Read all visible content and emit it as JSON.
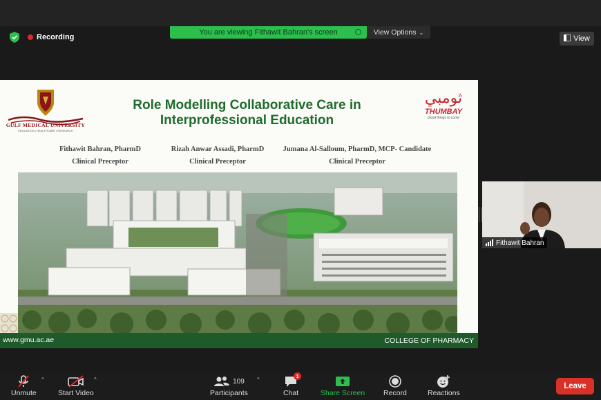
{
  "banner": {
    "text": "You are viewing Fithawit Bahran's screen"
  },
  "view_options": {
    "label": "View Options"
  },
  "recording": {
    "label": "Recording"
  },
  "view_button": {
    "label": "View"
  },
  "slide": {
    "title_line1": "Role Modelling Collaborative Care in",
    "title_line2": "Interprofessional Education",
    "left_logo": {
      "name": "GULF MEDICAL UNIVERSITY",
      "sub": "EDUCATION • HEALTHCARE • RESEARCH"
    },
    "right_logo": {
      "mark": "ثومبي",
      "name": "THUMBAY",
      "tagline": "Good things to come"
    },
    "presenters": [
      {
        "name": "Fithawit Bahran, PharmD",
        "role": "Clinical Preceptor"
      },
      {
        "name": "Rizah Anwar Assadi, PharmD",
        "role": "Clinical Preceptor"
      },
      {
        "name": "Jumana Al-Salloum, PharmD, MCP- Candidate",
        "role": "Clinical Preceptor"
      }
    ],
    "footer_site": "www.gmu.ac.ae",
    "footer_college": "COLLEGE OF PHARMACY"
  },
  "participant": {
    "name": "Fithawit Bahran"
  },
  "toolbar": {
    "unmute": "Unmute",
    "start_video": "Start Video",
    "participants": "Participants",
    "participants_count": "109",
    "chat": "Chat",
    "chat_badge": "1",
    "share_screen": "Share Screen",
    "record": "Record",
    "reactions": "Reactions",
    "leave": "Leave"
  },
  "colors": {
    "share_green": "#2dbf4e",
    "leave_red": "#d93127",
    "title_green": "#1f6b2d",
    "footer_green": "#1f5a2a"
  }
}
